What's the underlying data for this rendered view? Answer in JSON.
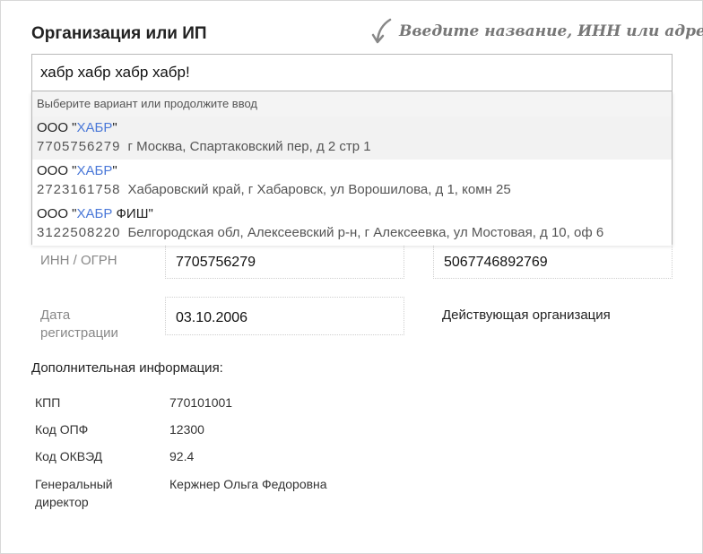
{
  "form": {
    "title": "Организация или ИП",
    "hint": "Введите название, ИНН или адрес",
    "search_value": "хабр хабр хабр хабр!"
  },
  "suggestions": {
    "hint": "Выберите вариант или продолжите ввод",
    "items": [
      {
        "prefix": "ООО \"",
        "match": "ХАБР",
        "suffix": "\"",
        "inn": "7705756279",
        "address": "г Москва, Спартаковский пер, д 2 стр 1"
      },
      {
        "prefix": "ООО \"",
        "match": "ХАБР",
        "suffix": "\"",
        "inn": "2723161758",
        "address": "Хабаровский край, г Хабаровск, ул Ворошилова, д 1, комн 25"
      },
      {
        "prefix": "ООО \"",
        "match": "ХАБР",
        "suffix": " ФИШ\"",
        "inn": "3122508220",
        "address": "Белгородская обл, Алексеевский р-н, г Алексеевка, ул Мостовая, д 10, оф 6"
      }
    ]
  },
  "details": {
    "inn_ogrn_label": "ИНН / ОГРН",
    "inn_value": "7705756279",
    "ogrn_value": "5067746892769",
    "reg_date_label_1": "Дата",
    "reg_date_label_2": "регистрации",
    "reg_date_value": "03.10.2006",
    "status": "Действующая организация"
  },
  "additional": {
    "title": "Дополнительная информация:",
    "rows": [
      {
        "key": "КПП",
        "value": "770101001"
      },
      {
        "key": "Код ОПФ",
        "value": "12300"
      },
      {
        "key": "Код ОКВЭД",
        "value": "92.4"
      },
      {
        "key_line1": "Генеральный",
        "key_line2": "директор",
        "value": "Кержнер Ольга Федоровна"
      }
    ]
  },
  "colors": {
    "highlight": "#4a78d8",
    "hint_text": "#777777",
    "border": "#b9b9b9"
  }
}
